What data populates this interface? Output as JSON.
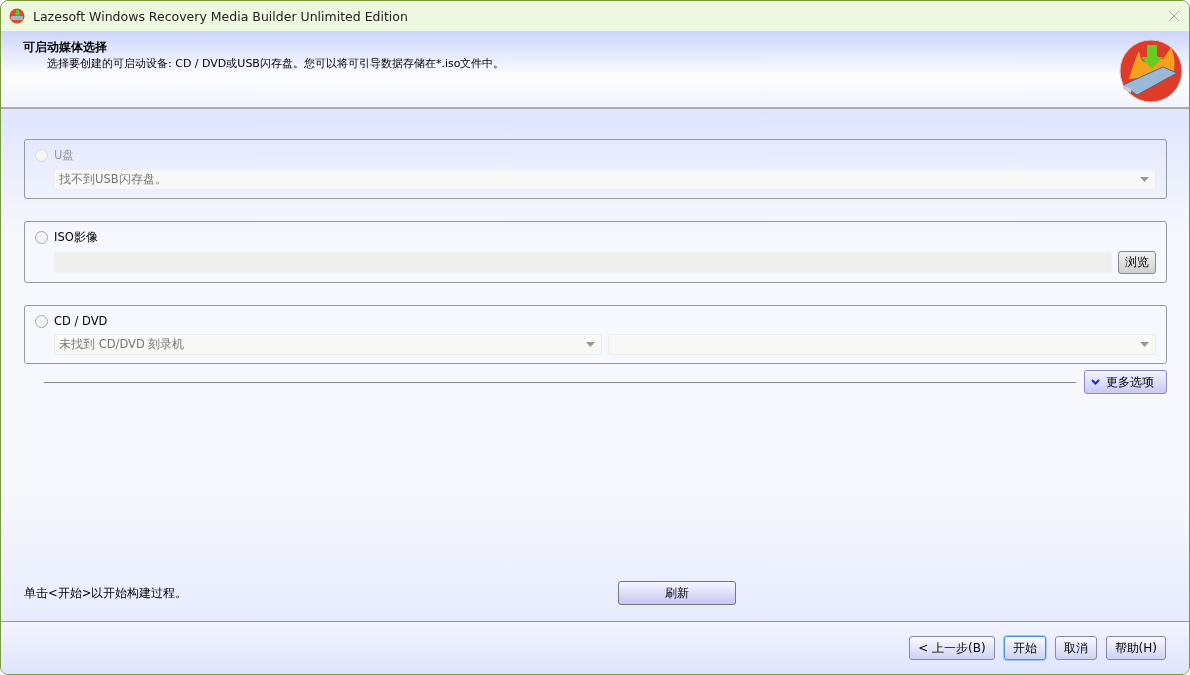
{
  "window": {
    "title": "Lazesoft Windows Recovery Media Builder Unlimited Edition"
  },
  "header": {
    "title": "可启动媒体选择",
    "description": "选择要创建的可启动设备: CD / DVD或USB闪存盘。您可以将可引导数据存储在*.iso文件中。"
  },
  "options": [
    {
      "kind": "dropdown",
      "label": "U盘",
      "selected": false,
      "disabled": true,
      "value": "找不到USB闪存盘。"
    },
    {
      "kind": "file",
      "label": "ISO影像",
      "selected": false,
      "disabled": false,
      "button": "浏览"
    },
    {
      "kind": "dual-dropdown",
      "label": "CD / DVD",
      "selected": false,
      "disabled": false,
      "value": "未找到 CD/DVD 刻录机"
    }
  ],
  "more_options": "更多选项",
  "hint": "单击<开始>以开始构建过程。",
  "refresh": "刷新",
  "buttons": [
    {
      "label": "< 上一步(B)",
      "focused": false
    },
    {
      "label": "开始",
      "focused": true
    },
    {
      "label": "取消",
      "focused": false
    },
    {
      "label": "帮助(H)",
      "focused": false
    }
  ]
}
